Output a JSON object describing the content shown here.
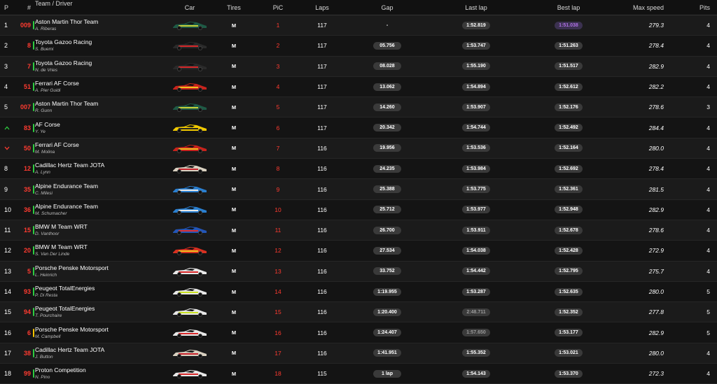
{
  "columns": {
    "pos": "P",
    "num": "#",
    "team": "Team / Driver",
    "car": "Car",
    "tires": "Tires",
    "pic": "PiC",
    "laps": "Laps",
    "gap": "Gap",
    "last": "Last lap",
    "best": "Best lap",
    "speed": "Max speed",
    "pits": "Pits"
  },
  "colors": {
    "number_red": "#ff3b30",
    "flag_green": "#2ecc40",
    "flag_yellow": "#f5c400",
    "best_purple": "#b071e6",
    "arrow_up": "#2ecc40",
    "arrow_down": "#ff3b30"
  },
  "rows": [
    {
      "pos": "1",
      "num": "009",
      "flag": "green",
      "team": "Aston Martin Thor Team",
      "driver": "A. Riberas",
      "car_color": "#1e5a45",
      "car_accent": "#c8d23a",
      "tire": "M",
      "pic": "1",
      "laps": "117",
      "gap": "-",
      "gap_style": "plain",
      "last": "1:52.819",
      "last_style": "",
      "best": "1:51.038",
      "best_style": "purple",
      "speed": "279.3",
      "pits": "4"
    },
    {
      "pos": "2",
      "num": "8",
      "flag": "green",
      "team": "Toyota Gazoo Racing",
      "driver": "S. Buemi",
      "car_color": "#2a2a2a",
      "car_accent": "#d8282a",
      "tire": "M",
      "pic": "2",
      "laps": "117",
      "gap": "05.756",
      "gap_style": "",
      "last": "1:53.747",
      "last_style": "",
      "best": "1:51.263",
      "best_style": "",
      "speed": "278.4",
      "pits": "4"
    },
    {
      "pos": "3",
      "num": "7",
      "flag": "green",
      "team": "Toyota Gazoo Racing",
      "driver": "N. de Vries",
      "car_color": "#2a2a2a",
      "car_accent": "#d8282a",
      "tire": "M",
      "pic": "3",
      "laps": "117",
      "gap": "08.028",
      "gap_style": "",
      "last": "1:55.190",
      "last_style": "",
      "best": "1:51.517",
      "best_style": "",
      "speed": "282.9",
      "pits": "4"
    },
    {
      "pos": "4",
      "num": "51",
      "flag": "green",
      "team": "Ferrari AF Corse",
      "driver": "A. Pier Guidi",
      "car_color": "#c8231c",
      "car_accent": "#f0c020",
      "tire": "M",
      "pic": "4",
      "laps": "117",
      "gap": "13.062",
      "gap_style": "",
      "last": "1:54.894",
      "last_style": "",
      "best": "1:52.612",
      "best_style": "",
      "speed": "282.2",
      "pits": "4"
    },
    {
      "pos": "5",
      "num": "007",
      "flag": "green",
      "team": "Aston Martin Thor Team",
      "driver": "R. Gunn",
      "car_color": "#1e5a45",
      "car_accent": "#c8d23a",
      "tire": "M",
      "pic": "5",
      "laps": "117",
      "gap": "14.260",
      "gap_style": "",
      "last": "1:53.907",
      "last_style": "",
      "best": "1:52.176",
      "best_style": "",
      "speed": "278.6",
      "pits": "3"
    },
    {
      "pos": "^",
      "pos_type": "up",
      "num": "83",
      "flag": "green",
      "team": "AF Corse",
      "driver": "Y. Ye",
      "car_color": "#f0c800",
      "car_accent": "#222222",
      "tire": "M",
      "pic": "6",
      "laps": "117",
      "gap": "20.342",
      "gap_style": "",
      "last": "1:54.744",
      "last_style": "",
      "best": "1:52.492",
      "best_style": "",
      "speed": "284.4",
      "pits": "4"
    },
    {
      "pos": "v",
      "pos_type": "down",
      "num": "50",
      "flag": "green",
      "team": "Ferrari AF Corse",
      "driver": "M. Molina",
      "car_color": "#c8231c",
      "car_accent": "#f0c020",
      "tire": "M",
      "pic": "7",
      "laps": "116",
      "gap": "19.956",
      "gap_style": "",
      "last": "1:53.536",
      "last_style": "",
      "best": "1:52.164",
      "best_style": "",
      "speed": "280.0",
      "pits": "4"
    },
    {
      "pos": "8",
      "num": "12",
      "flag": "green",
      "team": "Cadillac Hertz Team JOTA",
      "driver": "A. Lynn",
      "car_color": "#d8d0c0",
      "car_accent": "#c8232c",
      "tire": "M",
      "pic": "8",
      "laps": "116",
      "gap": "24.235",
      "gap_style": "",
      "last": "1:53.984",
      "last_style": "",
      "best": "1:52.692",
      "best_style": "",
      "speed": "278.4",
      "pits": "4"
    },
    {
      "pos": "9",
      "num": "35",
      "flag": "green",
      "team": "Alpine Endurance Team",
      "driver": "C. Milesi",
      "car_color": "#2a7fd0",
      "car_accent": "#e8e8e8",
      "tire": "M",
      "pic": "9",
      "laps": "116",
      "gap": "25.388",
      "gap_style": "",
      "last": "1:53.775",
      "last_style": "",
      "best": "1:52.361",
      "best_style": "",
      "speed": "281.5",
      "pits": "4"
    },
    {
      "pos": "10",
      "num": "36",
      "flag": "green",
      "team": "Alpine Endurance Team",
      "driver": "M. Schumacher",
      "car_color": "#2a7fd0",
      "car_accent": "#e8e8e8",
      "tire": "M",
      "pic": "10",
      "laps": "116",
      "gap": "25.712",
      "gap_style": "",
      "last": "1:53.977",
      "last_style": "",
      "best": "1:52.948",
      "best_style": "",
      "speed": "282.9",
      "pits": "4"
    },
    {
      "pos": "11",
      "num": "15",
      "flag": "green",
      "team": "BMW M Team WRT",
      "driver": "D. Vanthoor",
      "car_color": "#2356b8",
      "car_accent": "#e03030",
      "tire": "M",
      "pic": "11",
      "laps": "116",
      "gap": "26.700",
      "gap_style": "",
      "last": "1:53.911",
      "last_style": "",
      "best": "1:52.678",
      "best_style": "",
      "speed": "278.6",
      "pits": "4"
    },
    {
      "pos": "12",
      "num": "20",
      "flag": "green",
      "team": "BMW M Team WRT",
      "driver": "S. Van Der Linde",
      "car_color": "#d83020",
      "car_accent": "#f0c020",
      "tire": "M",
      "pic": "12",
      "laps": "116",
      "gap": "27.534",
      "gap_style": "",
      "last": "1:54.038",
      "last_style": "",
      "best": "1:52.428",
      "best_style": "",
      "speed": "272.9",
      "pits": "4"
    },
    {
      "pos": "13",
      "num": "5",
      "flag": "green",
      "team": "Porsche Penske Motorsport",
      "driver": "L. Heinrich",
      "car_color": "#e8e8e8",
      "car_accent": "#d8282a",
      "tire": "M",
      "pic": "13",
      "laps": "116",
      "gap": "33.752",
      "gap_style": "",
      "last": "1:54.442",
      "last_style": "",
      "best": "1:52.795",
      "best_style": "",
      "speed": "275.7",
      "pits": "4"
    },
    {
      "pos": "14",
      "num": "93",
      "flag": "green",
      "team": "Peugeot TotalEnergies",
      "driver": "P. Di Resta",
      "car_color": "#e8e8e8",
      "car_accent": "#c8e020",
      "tire": "M",
      "pic": "14",
      "laps": "116",
      "gap": "1:19.955",
      "gap_style": "",
      "last": "1:53.287",
      "last_style": "",
      "best": "1:52.635",
      "best_style": "",
      "speed": "280.0",
      "pits": "5"
    },
    {
      "pos": "15",
      "num": "94",
      "flag": "green",
      "team": "Peugeot TotalEnergies",
      "driver": "T. Pourchaire",
      "car_color": "#e8e8e8",
      "car_accent": "#c8e020",
      "tire": "M",
      "pic": "15",
      "laps": "116",
      "gap": "1:20.400",
      "gap_style": "",
      "last": "2:48.711",
      "last_style": "dim",
      "best": "1:52.352",
      "best_style": "",
      "speed": "277.8",
      "pits": "5"
    },
    {
      "pos": "16",
      "num": "6",
      "flag": "yellow",
      "team": "Porsche Penske Motorsport",
      "driver": "M. Campbell",
      "car_color": "#e8e8e8",
      "car_accent": "#d8282a",
      "tire": "M",
      "pic": "16",
      "laps": "116",
      "gap": "1:24.407",
      "gap_style": "",
      "last": "1:57.650",
      "last_style": "dim",
      "best": "1:53.177",
      "best_style": "",
      "speed": "282.9",
      "pits": "5"
    },
    {
      "pos": "17",
      "num": "38",
      "flag": "green",
      "team": "Cadillac Hertz Team JOTA",
      "driver": "J. Button",
      "car_color": "#d8d0c0",
      "car_accent": "#c8232c",
      "tire": "M",
      "pic": "17",
      "laps": "116",
      "gap": "1:41.951",
      "gap_style": "",
      "last": "1:55.352",
      "last_style": "",
      "best": "1:53.021",
      "best_style": "",
      "speed": "280.0",
      "pits": "4"
    },
    {
      "pos": "18",
      "num": "99",
      "flag": "green",
      "team": "Proton Competition",
      "driver": "N. Pino",
      "car_color": "#e8e8e8",
      "car_accent": "#d8282a",
      "tire": "M",
      "pic": "18",
      "laps": "115",
      "gap": "1 lap",
      "gap_style": "",
      "last": "1:54.143",
      "last_style": "",
      "best": "1:53.370",
      "best_style": "",
      "speed": "272.3",
      "pits": "4"
    }
  ]
}
